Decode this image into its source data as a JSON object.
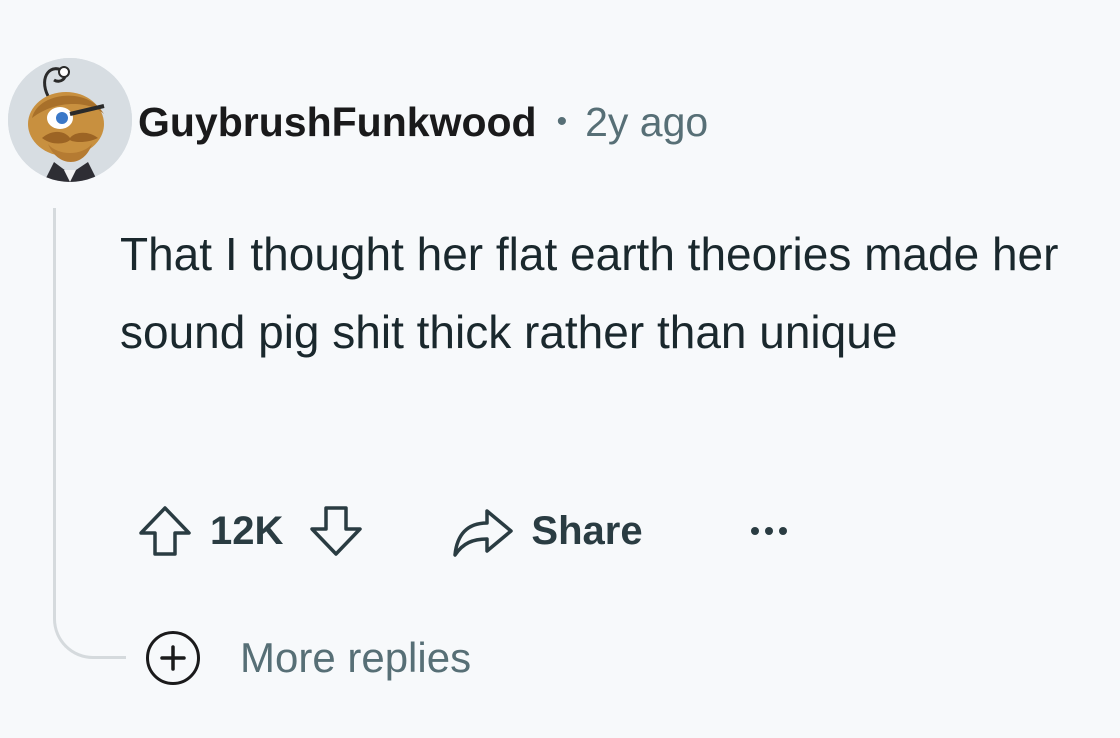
{
  "comment": {
    "author": "GuybrushFunkwood",
    "separator": "•",
    "age": "2y ago",
    "body": "That I thought her flat earth theories made her sound pig shit thick rather than unique",
    "avatar_icon": "snoo-avatar-icon"
  },
  "actions": {
    "upvote_icon": "upvote-arrow-icon",
    "score": "12K",
    "downvote_icon": "downvote-arrow-icon",
    "share_icon": "share-arrow-icon",
    "share_label": "Share",
    "overflow_icon": "more-horizontal-icon"
  },
  "thread": {
    "more_replies_icon": "plus-circle-icon",
    "more_replies_label": "More replies"
  },
  "colors": {
    "background": "#f7f9fb",
    "text_primary": "#1a282d",
    "text_secondary": "#576f76",
    "thread_line": "#d5dadd"
  }
}
